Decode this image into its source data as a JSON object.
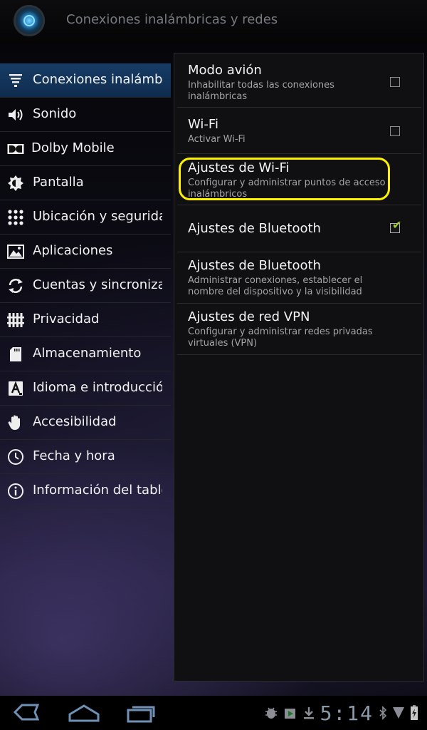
{
  "action_bar": {
    "title": "Conexiones inalámbricas y redes",
    "app_icon": "settings-orb-icon"
  },
  "headers": [
    {
      "label": "Conexiones inalámbricas y redes",
      "icon": "wireless-icon",
      "selected": true
    },
    {
      "label": "Sonido",
      "icon": "speaker-icon"
    },
    {
      "label": "Dolby Mobile",
      "icon": "dolby-icon"
    },
    {
      "label": "Pantalla",
      "icon": "brightness-icon"
    },
    {
      "label": "Ubicación y seguridad",
      "icon": "location-grid-icon"
    },
    {
      "label": "Aplicaciones",
      "icon": "applications-icon"
    },
    {
      "label": "Cuentas y sincronización",
      "icon": "sync-icon"
    },
    {
      "label": "Privacidad",
      "icon": "privacy-icon"
    },
    {
      "label": "Almacenamiento",
      "icon": "sd-card-icon"
    },
    {
      "label": "Idioma e introducción",
      "icon": "language-icon"
    },
    {
      "label": "Accesibilidad",
      "icon": "hand-icon"
    },
    {
      "label": "Fecha y hora",
      "icon": "clock-icon"
    },
    {
      "label": "Información del tablet",
      "icon": "info-icon"
    }
  ],
  "preferences": [
    {
      "title": "Modo avión",
      "summary": "Inhabilitar todas las conexiones inalámbricas",
      "checkbox": true,
      "checked": false
    },
    {
      "title": "Wi-Fi",
      "summary": "Activar Wi-Fi",
      "checkbox": true,
      "checked": false
    },
    {
      "title": "Ajustes de Wi-Fi",
      "summary": "Configurar y administrar puntos de acceso inalámbricos"
    },
    {
      "title": "Ajustes de Bluetooth",
      "summary": "",
      "checkbox": true,
      "checked": true
    },
    {
      "title": "Ajustes de Bluetooth",
      "summary": "Administrar conexiones, establecer el nombre del dispositivo y la visibilidad"
    },
    {
      "title": "Ajustes de red VPN",
      "summary": "Configurar y administrar redes privadas virtuales (VPN)"
    }
  ],
  "annotation": {
    "highlight_color": "#fff200",
    "target": "Ajustes de Wi-Fi"
  },
  "system_bar": {
    "clock": "5:14",
    "nav": [
      "back-icon",
      "home-icon",
      "recent-apps-icon"
    ],
    "status_icons": [
      "android-debug-icon",
      "media-play-icon",
      "download-icon",
      "bluetooth-icon",
      "signal-icon",
      "battery-charging-icon"
    ]
  },
  "colors": {
    "selected_header": "#173c66",
    "checkmark": "#9bd12a",
    "clock": "#8a99aa"
  }
}
